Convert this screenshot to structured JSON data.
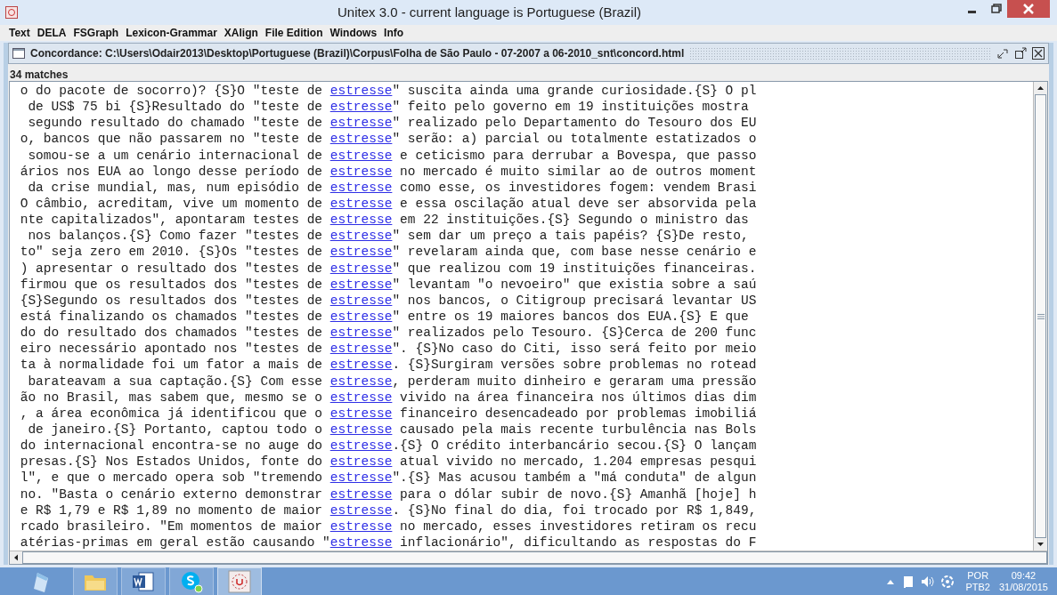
{
  "window": {
    "title": "Unitex 3.0 - current language is Portuguese (Brazil)"
  },
  "menu": [
    "Text",
    "DELA",
    "FSGraph",
    "Lexicon-Grammar",
    "XAlign",
    "File Edition",
    "Windows",
    "Info"
  ],
  "frame": {
    "title": "Concordance: C:\\Users\\Odair2013\\Desktop\\Portuguese (Brazil)\\Corpus\\Folha de São Paulo - 07-2007 a 06-2010_snt\\concord.html",
    "status": "34 matches"
  },
  "lines": [
    {
      "left": "o do pacote de socorro)? {S}O \"teste de ",
      "match": "estresse",
      "right": "\" suscita ainda uma grande curiosidade.{S} O pl"
    },
    {
      "left": "de US$ 75 bi {S}Resultado do \"teste de ",
      "match": "estresse",
      "right": "\" feito pelo governo em 19 instituições mostra"
    },
    {
      "left": "segundo resultado do chamado \"teste de ",
      "match": "estresse",
      "right": "\" realizado pelo Departamento do Tesouro dos EU"
    },
    {
      "left": "o, bancos que não passarem no \"teste de ",
      "match": "estresse",
      "right": "\" serão: a) parcial ou totalmente estatizados o"
    },
    {
      "left": "somou-se a um cenário internacional de ",
      "match": "estresse",
      "right": " e ceticismo para derrubar a Bovespa, que passo"
    },
    {
      "left": "ários nos EUA ao longo desse período de ",
      "match": "estresse",
      "right": " no mercado é muito similar ao de outros moment"
    },
    {
      "left": "da crise mundial, mas, num episódio de ",
      "match": "estresse",
      "right": " como esse, os investidores fogem: vendem Brasi"
    },
    {
      "left": "O câmbio, acreditam, vive um momento de ",
      "match": "estresse",
      "right": " e essa oscilação atual deve ser absorvida pela"
    },
    {
      "left": "nte capitalizados\", apontaram testes de ",
      "match": "estresse",
      "right": " em 22 instituições.{S} Segundo o ministro das"
    },
    {
      "left": "nos balanços.{S} Como fazer \"testes de ",
      "match": "estresse",
      "right": "\" sem dar um preço a tais papéis? {S}De resto,"
    },
    {
      "left": "to\" seja zero em 2010. {S}Os \"testes de ",
      "match": "estresse",
      "right": "\" revelaram ainda que, com base nesse cenário e"
    },
    {
      "left": ") apresentar o resultado dos \"testes de ",
      "match": "estresse",
      "right": "\" que realizou com 19 instituições financeiras."
    },
    {
      "left": "firmou que os resultados dos \"testes de ",
      "match": "estresse",
      "right": "\" levantam \"o nevoeiro\" que existia sobre a saú"
    },
    {
      "left": "{S}Segundo os resultados dos \"testes de ",
      "match": "estresse",
      "right": "\" nos bancos, o Citigroup precisará levantar US"
    },
    {
      "left": "está finalizando os chamados \"testes de ",
      "match": "estresse",
      "right": "\" entre os 19 maiores bancos dos EUA.{S} E que"
    },
    {
      "left": "do do resultado dos chamados \"testes de ",
      "match": "estresse",
      "right": "\" realizados pelo Tesouro. {S}Cerca de 200 func"
    },
    {
      "left": "eiro necessário apontado nos \"testes de ",
      "match": "estresse",
      "right": "\". {S}No caso do Citi, isso será feito por meio"
    },
    {
      "left": "ta à normalidade foi um fator a mais de ",
      "match": "estresse",
      "right": ". {S}Surgiram versões sobre problemas no rotead"
    },
    {
      "left": "barateavam a sua captação.{S} Com esse ",
      "match": "estresse",
      "right": ", perderam muito dinheiro e geraram uma pressão"
    },
    {
      "left": "ão no Brasil, mas sabem que, mesmo se o ",
      "match": "estresse",
      "right": " vivido na área financeira nos últimos dias dim"
    },
    {
      "left": ", a área econômica já identificou que o ",
      "match": "estresse",
      "right": " financeiro desencadeado por problemas imobiliá"
    },
    {
      "left": "de janeiro.{S} Portanto, captou todo o ",
      "match": "estresse",
      "right": " causado pela mais recente turbulência nas Bols"
    },
    {
      "left": "do internacional encontra-se no auge do ",
      "match": "estresse",
      "right": ".{S} O crédito interbancário secou.{S} O lançam"
    },
    {
      "left": "presas.{S} Nos Estados Unidos, fonte do ",
      "match": "estresse",
      "right": " atual vivido no mercado, 1.204 empresas pesqui"
    },
    {
      "left": "l\", e que o mercado opera sob \"tremendo ",
      "match": "estresse",
      "right": "\".{S} Mas acusou também a \"má conduta\" de algun"
    },
    {
      "left": "no. \"Basta o cenário externo demonstrar ",
      "match": "estresse",
      "right": " para o dólar subir de novo.{S} Amanhã [hoje] h"
    },
    {
      "left": "e R$ 1,79 e R$ 1,89 no momento de maior ",
      "match": "estresse",
      "right": ". {S}No final do dia, foi trocado por R$ 1,849,"
    },
    {
      "left": "rcado brasileiro. \"Em momentos de maior ",
      "match": "estresse",
      "right": " no mercado, esses investidores retiram os recu"
    },
    {
      "left": "atérias-primas em geral estão causando \"",
      "match": "estresse",
      "right": " inflacionário\", dificultando as respostas do F"
    }
  ],
  "tray": {
    "language": "POR",
    "layout": "PTB2",
    "time": "09:42",
    "date": "31/08/2015"
  }
}
